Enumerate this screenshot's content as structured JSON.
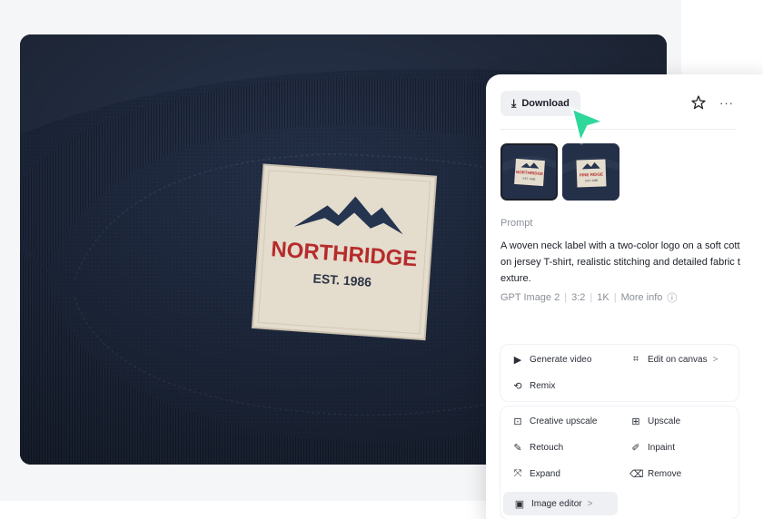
{
  "image": {
    "label_brand": "NORTHRIDGE",
    "label_est": "EST. 1986"
  },
  "thumbnail_1": {
    "brand": "NORTHRIDGE",
    "est": "EST. 1986"
  },
  "thumbnail_2": {
    "brand": "PINE RIDGE",
    "est": "EST. 1986"
  },
  "panel": {
    "download_label": "Download",
    "star_icon": "star-icon",
    "more_icon": "more-icon",
    "prompt_label": "Prompt",
    "prompt_text": "A woven neck label with a two-color logo on a soft cotton jersey T-shirt, realistic stitching and detailed fabric texture.",
    "meta": {
      "model": "GPT Image 2",
      "ratio": "3:2",
      "resolution": "1K",
      "more_info": "More info"
    },
    "actions_group1": [
      {
        "label": "Generate video",
        "icon": "play-icon"
      },
      {
        "label": "Edit on canvas",
        "icon": "crop-icon",
        "chevron": ">"
      },
      {
        "label": "Remix",
        "icon": "remix-icon"
      }
    ],
    "actions_group2": [
      {
        "label": "Creative upscale",
        "icon": "creative-upscale-icon"
      },
      {
        "label": "Upscale",
        "icon": "upscale-icon"
      },
      {
        "label": "Retouch",
        "icon": "retouch-icon"
      },
      {
        "label": "Inpaint",
        "icon": "inpaint-icon"
      },
      {
        "label": "Expand",
        "icon": "expand-icon"
      },
      {
        "label": "Remove",
        "icon": "eraser-icon"
      },
      {
        "label": "Image editor",
        "icon": "image-editor-icon",
        "chevron": ">"
      }
    ]
  },
  "colors": {
    "shirt": "#1f2a3e",
    "label_fabric": "#e4dccd",
    "brand_red": "#b62b2b",
    "mountain_navy": "#25344f",
    "cursor_green": "#2fd79a"
  }
}
